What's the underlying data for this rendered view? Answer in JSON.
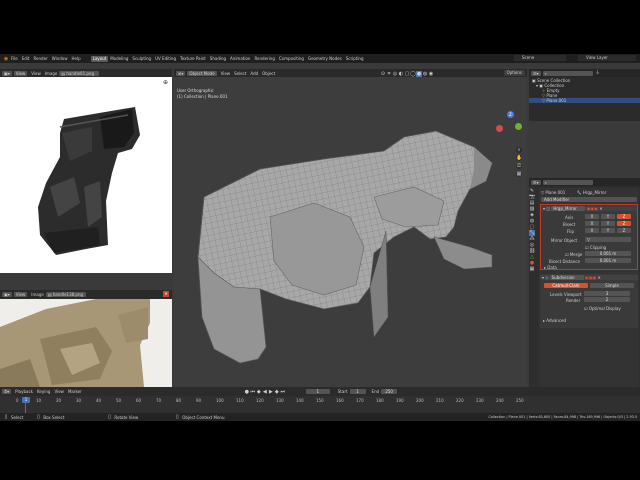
{
  "menu": {
    "items": [
      "File",
      "Edit",
      "Render",
      "Window",
      "Help"
    ],
    "workspaces": [
      "Layout",
      "Modeling",
      "Sculpting",
      "UV Editing",
      "Texture Paint",
      "Shading",
      "Animation",
      "Rendering",
      "Compositing",
      "Geometry Nodes",
      "Scripting"
    ],
    "active_workspace": "Layout",
    "scene": "Scene",
    "view_layer": "View Layer"
  },
  "image_editor_top": {
    "mode": "View",
    "menu": [
      "View",
      "Image"
    ],
    "image_name": "handle01.png"
  },
  "image_editor_bottom": {
    "mode": "View",
    "menu": [
      "Image"
    ],
    "image_name": "handle138.png"
  },
  "viewport": {
    "mode": "Object Mode",
    "menu": [
      "View",
      "Select",
      "Add",
      "Object"
    ],
    "info_line1": "User Orthographic",
    "info_line2": "(1) Collection | Plane.001",
    "gizmo_axes": [
      "X",
      "Y",
      "Z"
    ],
    "options_label": "Options"
  },
  "outliner": {
    "title": "Scene Collection",
    "items": [
      "Collection",
      "Empty",
      "Plane",
      "Plane.001"
    ]
  },
  "properties": {
    "object_name": "Plane.001",
    "mod_tab": "Hrgp_Mirror",
    "add_modifier": "Add Modifier",
    "mirror": {
      "name": "Hrgp_Mirror",
      "axis_label": "Axis",
      "bisect_label": "Bisect",
      "flip_label": "Flip",
      "axes": [
        "X",
        "Y",
        "Z"
      ],
      "mirror_object_label": "Mirror Object",
      "clipping_label": "Clipping",
      "merge_label": "Merge",
      "merge_value": "0.001 m",
      "bisect_distance_label": "Bisect Distance",
      "bisect_distance_value": "0.001 m",
      "data_label": "Data"
    },
    "subsurf": {
      "name": "Subdivision",
      "catmull": "Catmull-Clark",
      "simple": "Simple",
      "levels_label": "Levels Viewport",
      "levels_value": "3",
      "render_label": "Render",
      "render_value": "2",
      "optimal_label": "Optimal Display",
      "advanced_label": "Advanced"
    }
  },
  "timeline": {
    "menu": [
      "Playback",
      "Keying",
      "View",
      "Marker"
    ],
    "current_frame": "1",
    "start_label": "Start",
    "start_value": "1",
    "end_label": "End",
    "end_value": "250",
    "frame_field": "1",
    "ticks": [
      "0",
      "10",
      "20",
      "30",
      "40",
      "50",
      "60",
      "70",
      "80",
      "90",
      "100",
      "110",
      "120",
      "130",
      "140",
      "150",
      "160",
      "170",
      "180",
      "190",
      "200",
      "210",
      "220",
      "230",
      "240",
      "250"
    ]
  },
  "status": {
    "select": "Select",
    "box_select": "Box Select",
    "rotate_view": "Rotate View",
    "context_menu": "Object Context Menu",
    "stats": "Collection | Plane.001 | Verts:85,600 | Faces:84,998 | Tris:169,996 | Objects:0/3 | 2.93.5"
  },
  "colors": {
    "accent": "#d4532e",
    "active_blue": "#4772b3",
    "panel": "#303030",
    "header": "#2a2a2a"
  }
}
